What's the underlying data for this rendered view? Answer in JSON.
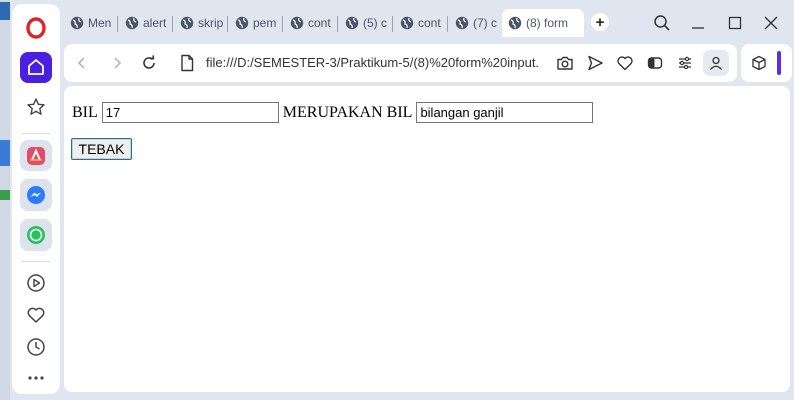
{
  "browser": {
    "tabs": [
      {
        "label": "Men"
      },
      {
        "label": "alert"
      },
      {
        "label": "skrip"
      },
      {
        "label": "pem"
      },
      {
        "label": "cont"
      },
      {
        "label": "(5) c"
      },
      {
        "label": "cont"
      },
      {
        "label": "(7) c"
      },
      {
        "label": "(8) form"
      }
    ],
    "new_tab_label": "+",
    "url": "file:///D:/SEMESTER-3/Praktikum-5/(8)%20form%20input."
  },
  "form": {
    "label_bil": "BIL",
    "bil_value": "17",
    "label_merupakan": "MERUPAKAN BIL",
    "result_value": "bilangan ganjil",
    "button_label": "TEBAK"
  },
  "colors": {
    "opera_red": "#e0242b",
    "home_accent": "#4b1fe0",
    "messenger": "#2d7bf6",
    "whatsapp": "#25c25a",
    "aria": "#e34b6b"
  },
  "icons": {
    "sidebar": [
      "opera-logo-icon",
      "home-icon",
      "star-icon",
      "aria-icon",
      "messenger-icon",
      "whatsapp-icon",
      "player-icon",
      "heart-icon",
      "history-icon",
      "more-icon"
    ],
    "toolbar": [
      "back-icon",
      "forward-icon",
      "reload-icon",
      "file-icon",
      "camera-icon",
      "send-icon",
      "heart-icon",
      "tab-snap-icon",
      "easy-setup-icon",
      "profile-icon",
      "extensions-icon"
    ],
    "window": [
      "search-tabs-icon",
      "minimize-icon",
      "maximize-icon",
      "close-icon"
    ]
  }
}
